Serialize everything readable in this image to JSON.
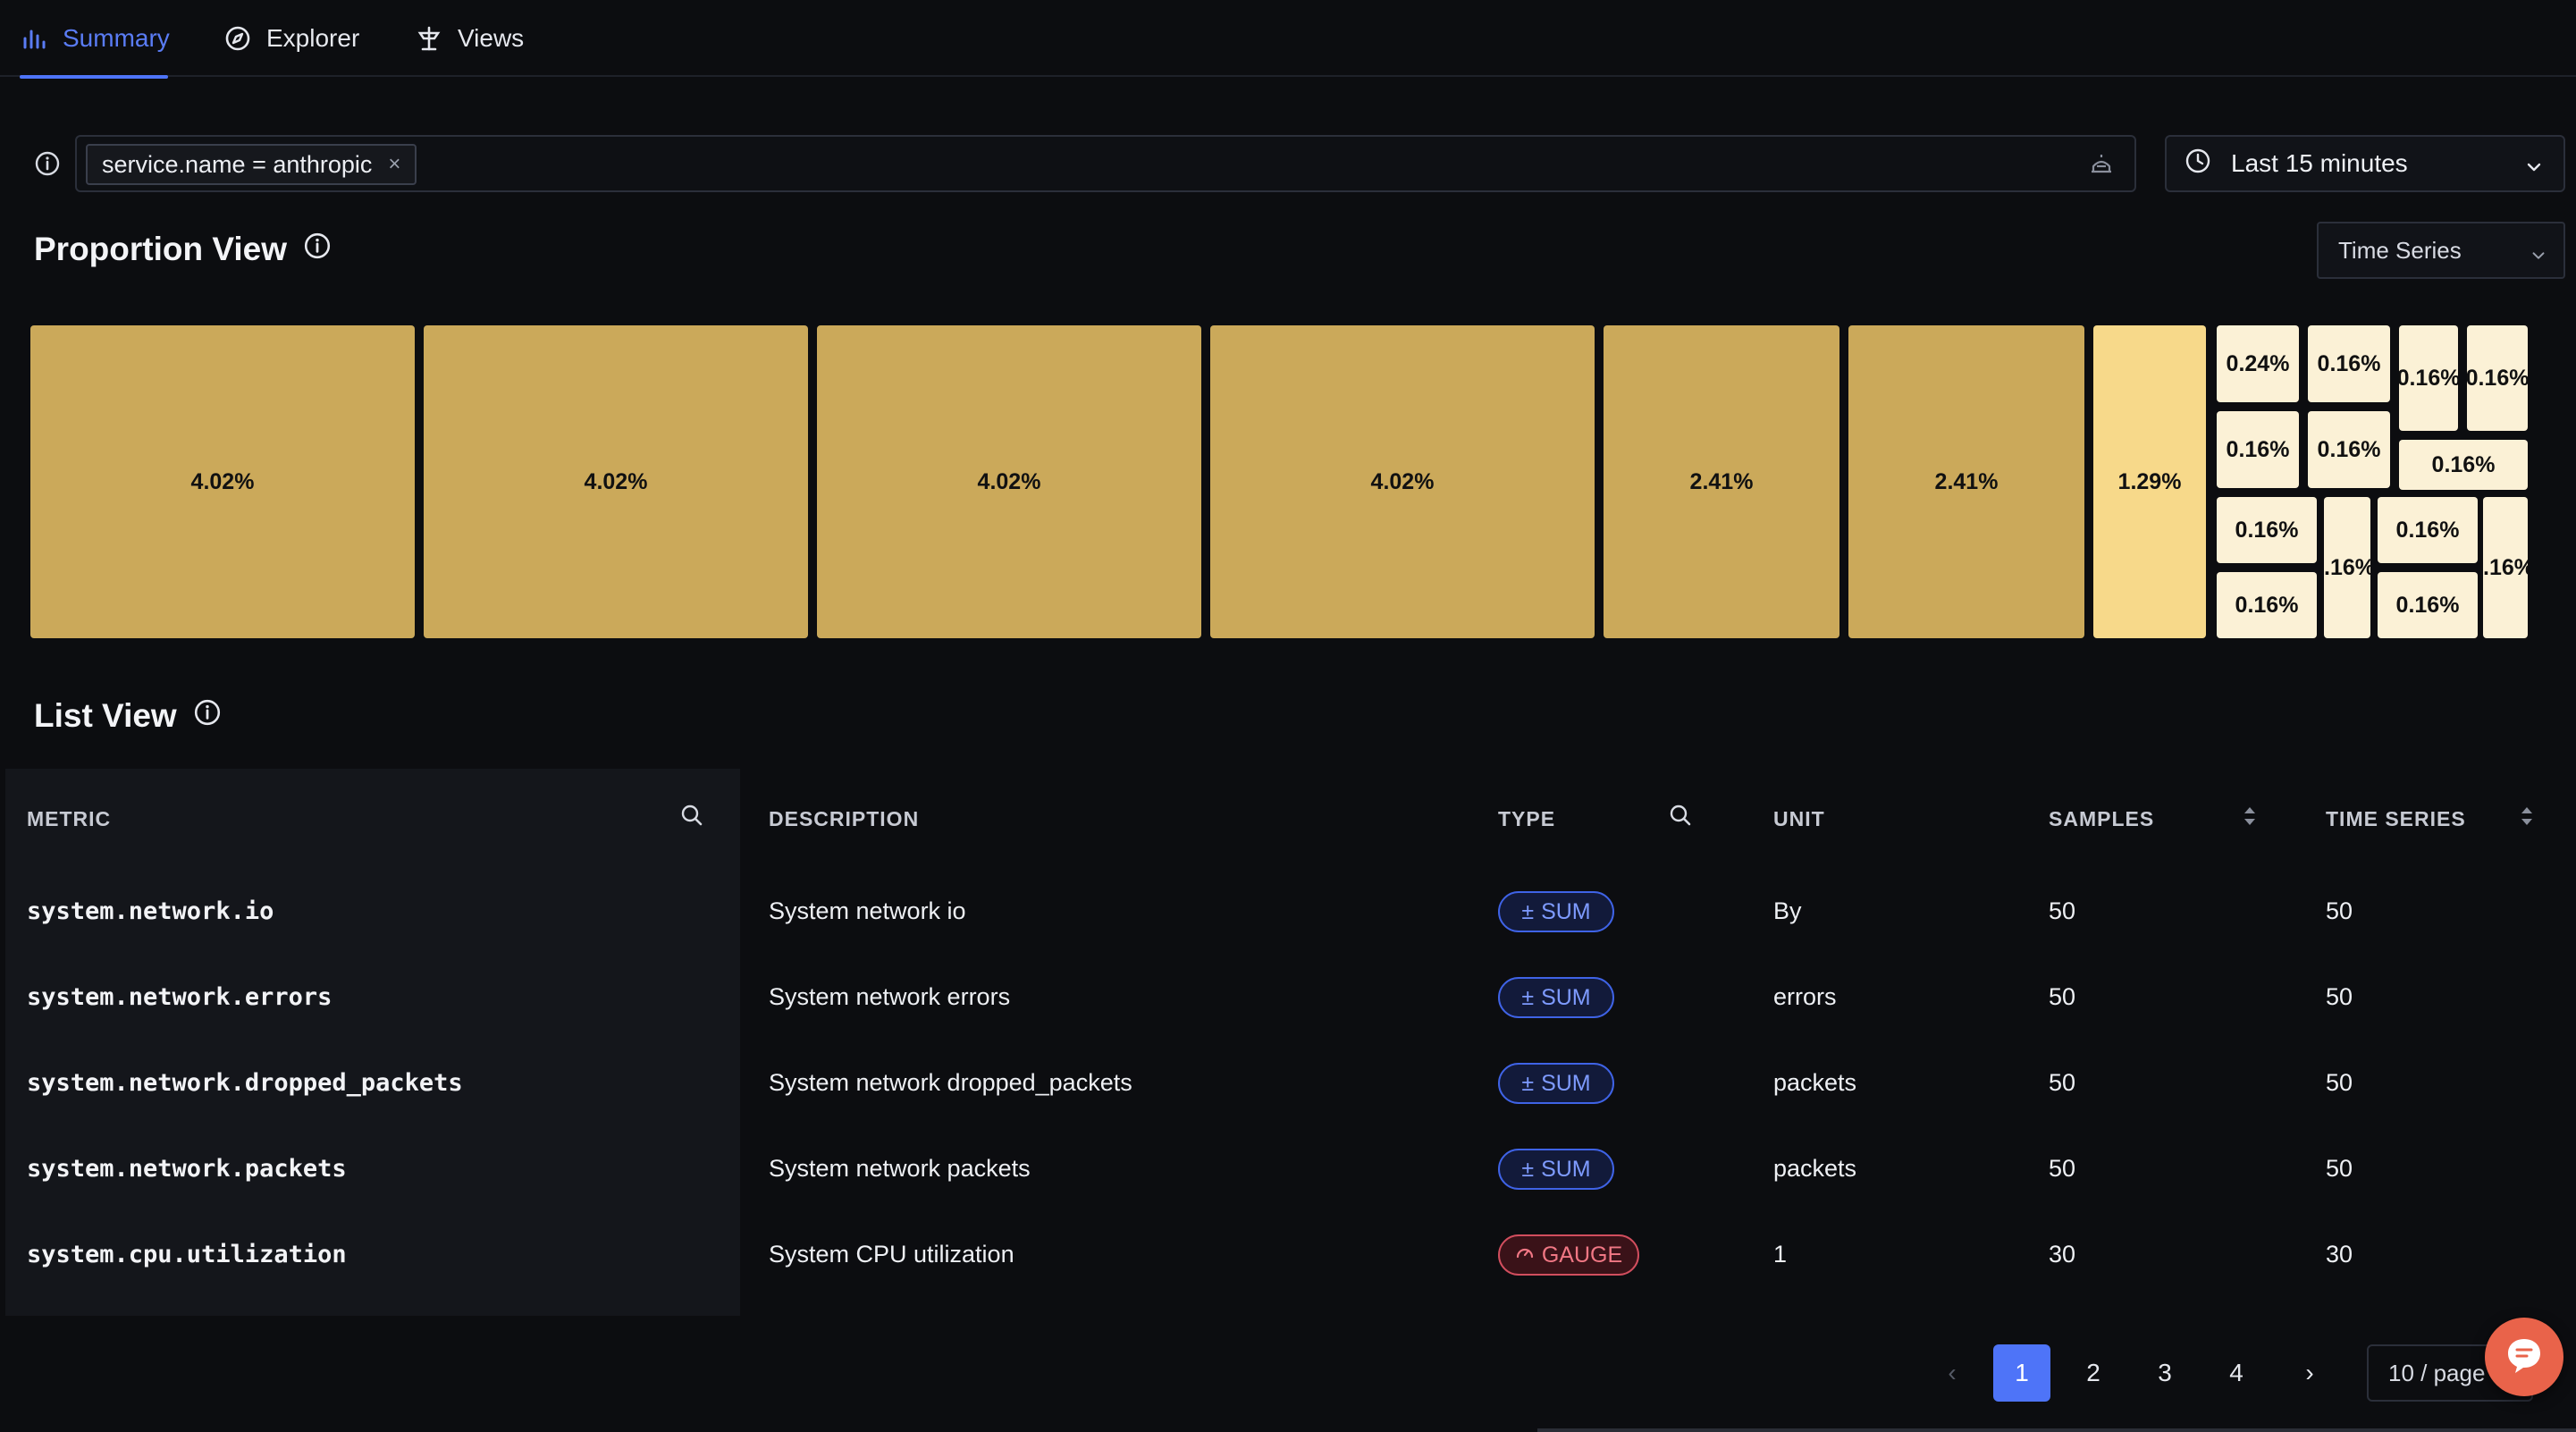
{
  "tabs": [
    {
      "label": "Summary",
      "icon": "bar-chart-icon",
      "active": true
    },
    {
      "label": "Explorer",
      "icon": "compass-icon",
      "active": false
    },
    {
      "label": "Views",
      "icon": "views-icon",
      "active": false
    }
  ],
  "filter": {
    "chip_label": "service.name = anthropic",
    "chip_close": "×"
  },
  "time_range": {
    "label": "Last 15 minutes"
  },
  "proportion_view": {
    "title": "Proportion View",
    "view_select": "Time Series",
    "cells": [
      {
        "label": "4.02%"
      },
      {
        "label": "4.02%"
      },
      {
        "label": "4.02%"
      },
      {
        "label": "4.02%"
      },
      {
        "label": "2.41%"
      },
      {
        "label": "2.41%"
      },
      {
        "label": "1.29%"
      },
      {
        "label": "0.24%"
      },
      {
        "label": "0.16%"
      },
      {
        "label": "0.16%"
      },
      {
        "label": "0.16%"
      },
      {
        "label": "0.16%"
      },
      {
        "label": "0.16%"
      },
      {
        "label": "0.16%"
      },
      {
        "label": "0.16%"
      },
      {
        "label": ".16%"
      },
      {
        "label": "0.16%"
      },
      {
        "label": ".16%"
      },
      {
        "label": "0.16%"
      },
      {
        "label": "0.16%"
      }
    ]
  },
  "list_view": {
    "title": "List View",
    "columns": {
      "metric": "METRIC",
      "description": "DESCRIPTION",
      "type": "TYPE",
      "unit": "UNIT",
      "samples": "SAMPLES",
      "time_series": "TIME SERIES"
    },
    "rows": [
      {
        "metric": "system.network.io",
        "description": "System network io",
        "type": "SUM",
        "type_icon": "±",
        "unit": "By",
        "samples": "50",
        "time_series": "50"
      },
      {
        "metric": "system.network.errors",
        "description": "System network errors",
        "type": "SUM",
        "type_icon": "±",
        "unit": "errors",
        "samples": "50",
        "time_series": "50"
      },
      {
        "metric": "system.network.dropped_packets",
        "description": "System network dropped_packets",
        "type": "SUM",
        "type_icon": "±",
        "unit": "packets",
        "samples": "50",
        "time_series": "50"
      },
      {
        "metric": "system.network.packets",
        "description": "System network packets",
        "type": "SUM",
        "type_icon": "±",
        "unit": "packets",
        "samples": "50",
        "time_series": "50"
      },
      {
        "metric": "system.cpu.utilization",
        "description": "System CPU utilization",
        "type": "GAUGE",
        "type_icon": "gauge-icon",
        "unit": "1",
        "samples": "30",
        "time_series": "30"
      }
    ]
  },
  "pagination": {
    "prev": "‹",
    "pages": [
      "1",
      "2",
      "3",
      "4"
    ],
    "current": "1",
    "next": "›",
    "page_size": "10 / page"
  },
  "colors": {
    "accent": "#4e74f8",
    "treemap_high": "#cba95a",
    "treemap_mid": "#f7d98a",
    "treemap_low": "#fbf1d6"
  }
}
